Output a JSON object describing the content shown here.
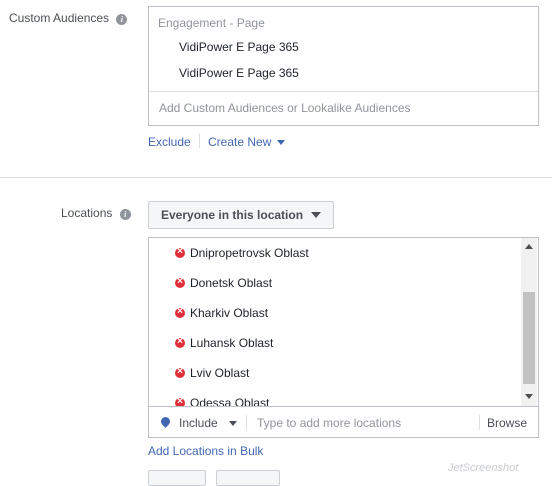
{
  "custom_audiences": {
    "label": "Custom Audiences",
    "info_glyph": "i",
    "group_heading": "Engagement - Page",
    "items": [
      "VidiPower E Page 365",
      "VidiPower E Page 365"
    ],
    "placeholder": "Add Custom Audiences or Lookalike Audiences",
    "exclude_label": "Exclude",
    "create_new_label": "Create New"
  },
  "locations": {
    "label": "Locations",
    "info_glyph": "i",
    "dropdown_value": "Everyone in this location",
    "items": [
      "Dnipropetrovsk Oblast",
      "Donetsk Oblast",
      "Kharkiv Oblast",
      "Luhansk Oblast",
      "Lviv Oblast",
      "Odessa Oblast"
    ],
    "include_label": "Include",
    "search_placeholder": "Type to add more locations",
    "browse_label": "Browse",
    "bulk_link": "Add Locations in Bulk"
  },
  "watermark": "JetScreenshot",
  "colors": {
    "link": "#4267b2",
    "pin": "#e02f3a",
    "border": "#bec3c9"
  }
}
